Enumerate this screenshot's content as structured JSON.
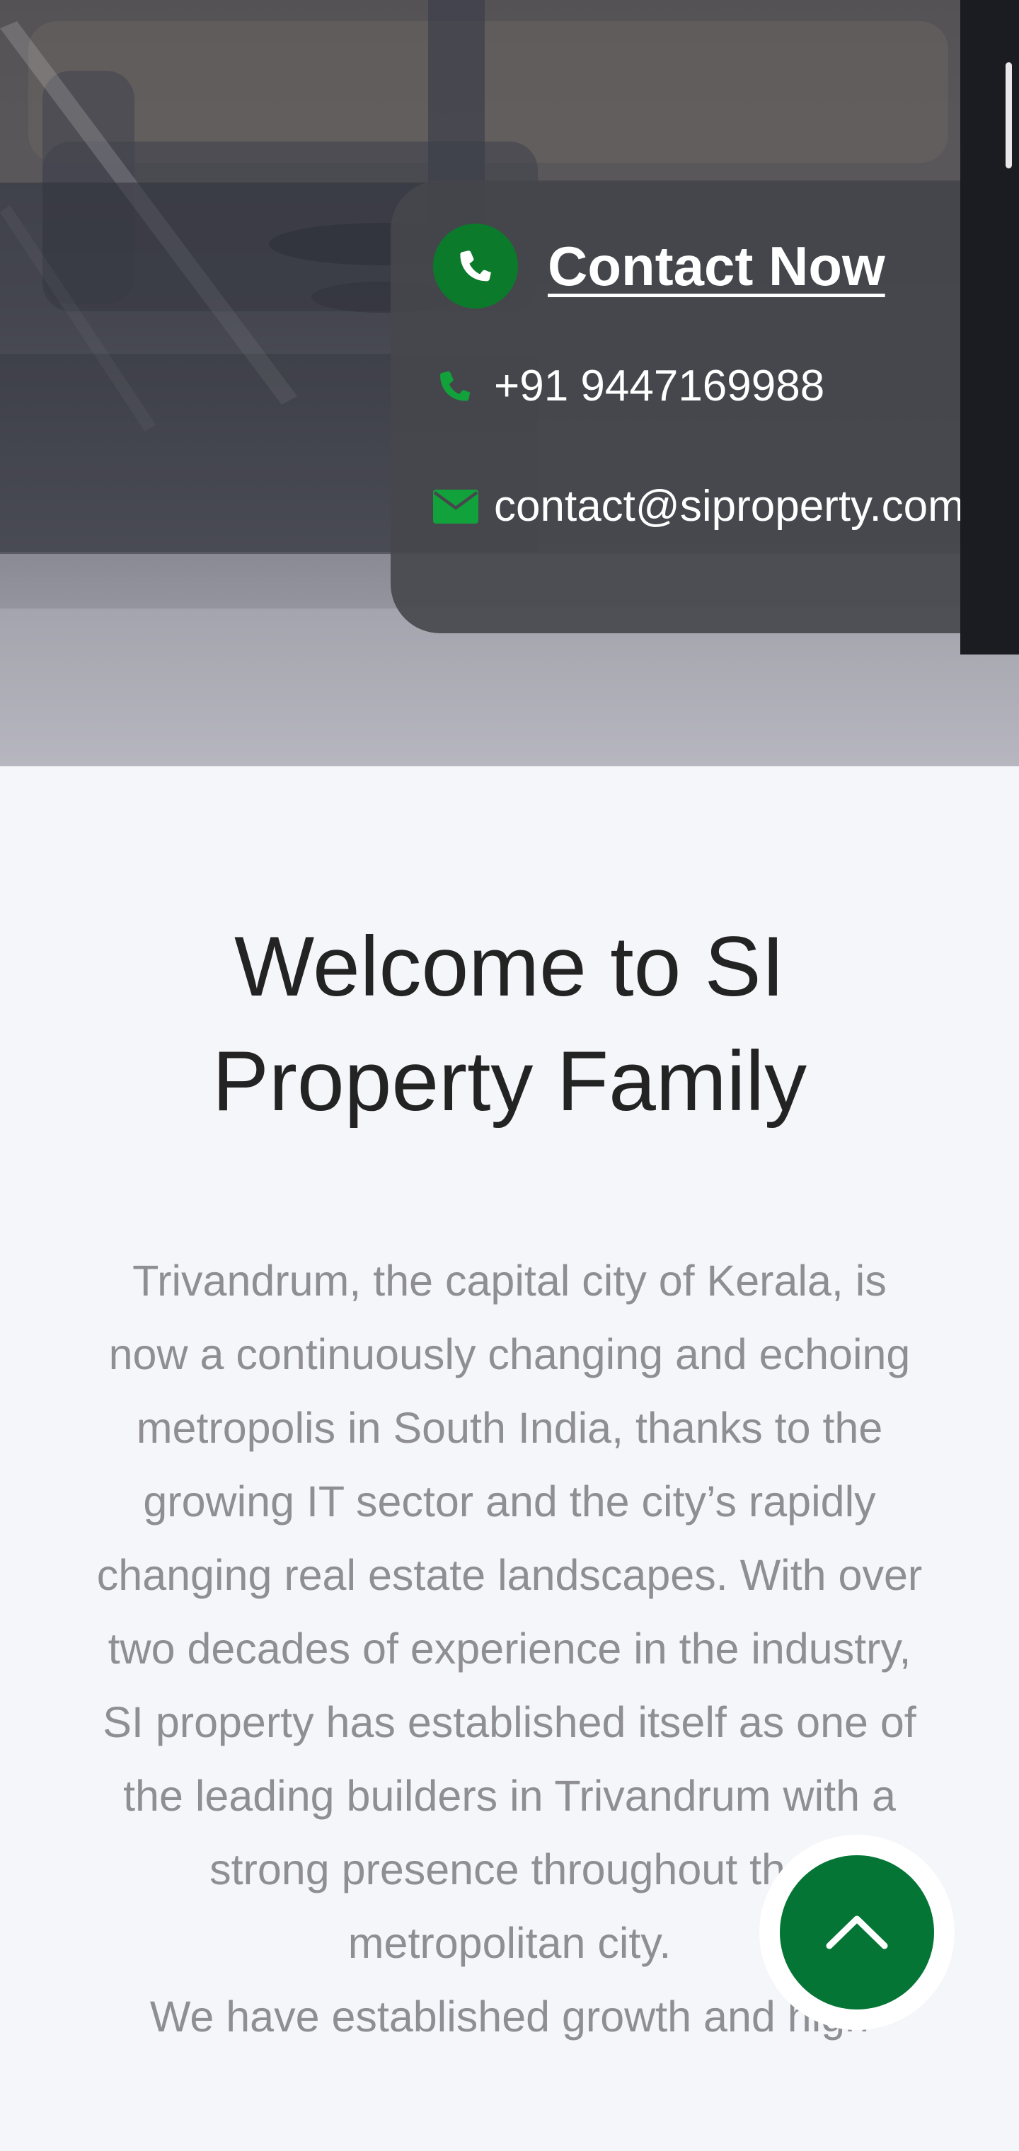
{
  "contact": {
    "heading": "Contact Now",
    "phone": "+91 9447169988",
    "email": "contact@siproperty.com",
    "icons": {
      "heading_icon": "phone-icon",
      "phone_icon": "phone-icon",
      "email_icon": "envelope-icon"
    }
  },
  "welcome": {
    "title": "Welcome to SI Property Family",
    "paragraphs": [
      "Trivandrum, the capital city of Kerala, is now a continuously changing and echoing metropolis in South India, thanks to the growing IT sector and the city’s rapidly changing real estate landscapes. With over two decades of experience in the industry, SI property has established itself as one of the leading builders in Trivandrum with a strong presence throughout the metropolitan city.",
      "We have established growth and high"
    ]
  },
  "back_to_top": {
    "icon": "chevron-up-icon"
  },
  "colors": {
    "accent_green": "#0b7a2a",
    "icon_green": "#12a23b",
    "back_to_top_green": "#047535",
    "title_text": "#232323",
    "body_text": "#8e8e93",
    "page_background": "#f5f6fa"
  }
}
